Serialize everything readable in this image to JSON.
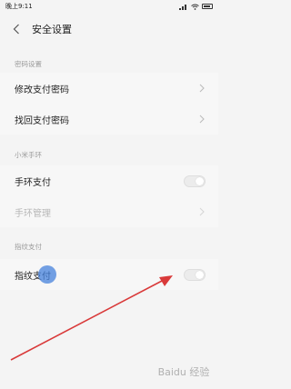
{
  "status_bar": {
    "time": "晚上9:11",
    "battery": ""
  },
  "header": {
    "title": "安全设置"
  },
  "sections": {
    "password": {
      "label": "密码设置"
    },
    "mi_band": {
      "label": "小米手环"
    },
    "fingerprint": {
      "label": "指纹支付"
    }
  },
  "rows": {
    "change_pay_password": "修改支付密码",
    "recover_pay_password": "找回支付密码",
    "band_pay": "手环支付",
    "band_manage": "手环管理",
    "fingerprint_pay": "指纹支付"
  },
  "toggles": {
    "band_pay": false,
    "fingerprint_pay": false
  },
  "watermark": "Baidu 经验",
  "colors": {
    "background": "#f4f4f4",
    "annotation_arrow": "#d93a3a",
    "touch_dot": "#4682dc"
  }
}
